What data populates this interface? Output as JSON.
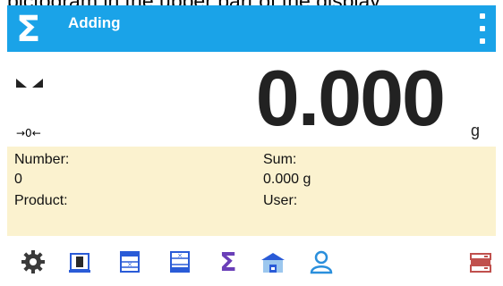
{
  "caption": {
    "text": "pictogram in the upper part of the display."
  },
  "header": {
    "title": "Adding",
    "logo_symbol": "Σ"
  },
  "display": {
    "value": "0.000",
    "unit": "g",
    "zero_indicator": "→0←"
  },
  "info": {
    "number_label": "Number:",
    "number_value": "0",
    "sum_label": "Sum:",
    "sum_value": "0.000 g",
    "product_label": "Product:",
    "user_label": "User:"
  },
  "toolbar": {
    "buttons": [
      {
        "icon": "gear-icon"
      },
      {
        "icon": "tare-icon"
      },
      {
        "icon": "database-icon"
      },
      {
        "icon": "database-add-icon"
      },
      {
        "icon": "sigma-icon",
        "symbol": "Σ"
      },
      {
        "icon": "warehouse-icon"
      },
      {
        "icon": "user-icon"
      },
      {
        "icon": "printer-icon"
      }
    ]
  },
  "colors": {
    "header": "#1aa3e8",
    "info_panel": "#fbf2cf",
    "icon_blue": "#2a5bd7",
    "icon_red": "#c0504d"
  }
}
